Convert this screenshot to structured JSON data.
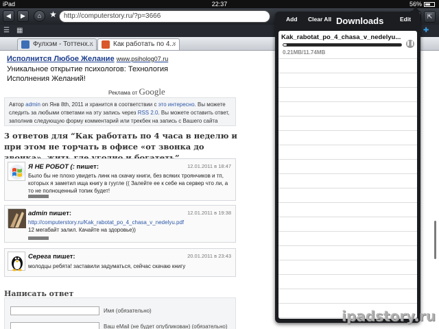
{
  "status_bar": {
    "device": "iPad",
    "time": "22:37",
    "battery": "56%",
    "battery_level": 0.56
  },
  "toolbar": {
    "url": "http://computerstory.ru/?p=3666"
  },
  "tabs": [
    {
      "title": "Фулхэм - Тоттенх...",
      "favicon_color": "#3d6fb6"
    },
    {
      "title": "Как работать по 4...",
      "favicon_color": "#d9572a",
      "active": true
    }
  ],
  "page": {
    "ad": {
      "link": "Исполнится Любое Желание",
      "source": "www.psiholog07.ru",
      "line1": "Уникальное открытие психологов: Технология",
      "line2": "Исполнения Желаний!"
    },
    "google_ads": {
      "prefix": "Реклама от",
      "brand": "Google"
    },
    "info": {
      "t1": "Автор",
      "author": "admin",
      "t2": "on Янв 8th, 2011 и хранится в соответствии с",
      "category": "это интересно",
      "t3": ". Вы можете следить за любыми ответами на эту запись через",
      "rss": "RSS 2.0",
      "t4": ". Вы можете оставить ответ, заполнив следующую форму комментарий или трекбек на запись с Вашего сайта"
    },
    "heading": "3 ответов для “Как работать по 4 часа в неделю и при этом не торчать в офисе «от звонка до звонка», жить где угодно и богатеть”",
    "comments": [
      {
        "author": "Я НЕ РОБОТ (:",
        "says": "пишет:",
        "date": "12.01.2011 в 18:47",
        "text": "Было бы не плохо увидеть линк на скачку книги, без всяких троянчиков и тп, которых я заметил ища книгу в гуугле (( Залейте ее к себе на сервер что ли, а то не полноценный топик будет!",
        "link": ""
      },
      {
        "author": "admin",
        "says": "пишет:",
        "date": "12.01.2011 в 19:38",
        "link": "http://computerstory.ru/Kak_rabotat_po_4_chasa_v_nedelyu.pdf",
        "text": "12 мегабайт залил. Качайте на здоровье))"
      },
      {
        "author": "Серега",
        "says": "пишет:",
        "date": "20.01.2011 в 23:43",
        "text": "молодцы ребята! заставили задуматься, сейчас скачаю книгу",
        "link": ""
      }
    ],
    "reply_title": "Написать ответ",
    "form": {
      "name_label": "Имя (обязательно)",
      "email_label": "Ваш eMail (не будет опубликован) (обязательно)"
    }
  },
  "downloads": {
    "add_label": "Add",
    "clear_label": "Clear All",
    "title": "Downloads",
    "edit_label": "Edit",
    "items": [
      {
        "name": "Kak_rabotat_po_4_chasa_v_nedelyu...",
        "size": "0.21MB/11.74MB",
        "progress": 0.018
      }
    ]
  },
  "watermark": "ipadstory.ru"
}
